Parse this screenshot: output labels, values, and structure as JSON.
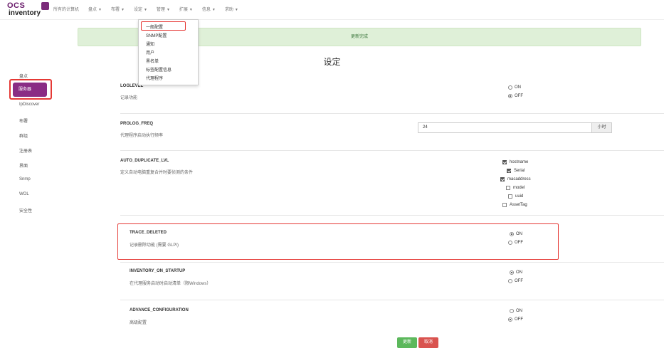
{
  "logo": {
    "line1": "OCS",
    "line2": "inventory"
  },
  "nav": [
    {
      "label": "所有的计算机",
      "caret": false
    },
    {
      "label": "盘点",
      "caret": true
    },
    {
      "label": "布署",
      "caret": true
    },
    {
      "label": "设定",
      "caret": true
    },
    {
      "label": "管理",
      "caret": true
    },
    {
      "label": "扩展",
      "caret": true
    },
    {
      "label": "信息",
      "caret": true
    },
    {
      "label": "求助",
      "caret": true
    }
  ],
  "dropdown": [
    "一般配置",
    "SNMP配置",
    "通知",
    "用户",
    "黑名单",
    "标签配置信息",
    "代理程序"
  ],
  "alert": "更新完成",
  "page_title": "设定",
  "sidebar": [
    "盘点",
    "服务器",
    "IpDiscover",
    "布署",
    "群组",
    "注册表",
    "界面",
    "Snmp",
    "WOL",
    "安全性"
  ],
  "settings": {
    "loglevel": {
      "name": "LOGLEVEL",
      "desc": "记录功能",
      "on": "ON",
      "off": "OFF",
      "selected": "OFF"
    },
    "prolog": {
      "name": "PROLOG_FREQ",
      "desc": "代理程序启动执行频率",
      "value": "24",
      "unit": "小时"
    },
    "autodup": {
      "name": "AUTO_DUPLICATE_LVL",
      "desc": "定义自动电脑重复合并时要侦测的条件",
      "options": [
        {
          "label": "hostname",
          "checked": true
        },
        {
          "label": "Serial",
          "checked": true
        },
        {
          "label": "macaddress",
          "checked": true
        },
        {
          "label": "model",
          "checked": false
        },
        {
          "label": "uuid",
          "checked": false
        },
        {
          "label": "AssetTag",
          "checked": false
        }
      ]
    },
    "trace": {
      "name": "TRACE_DELETED",
      "desc": "记录删除功能 (需要 GLPI)",
      "on": "ON",
      "off": "OFF",
      "selected": "ON"
    },
    "startup": {
      "name": "INVENTORY_ON_STARTUP",
      "desc": "在代理服务启动时启动清单（限Windows）",
      "on": "ON",
      "off": "OFF",
      "selected": "ON"
    },
    "advance": {
      "name": "ADVANCE_CONFIGURATION",
      "desc": "高级配置",
      "on": "ON",
      "off": "OFF",
      "selected": "OFF"
    }
  },
  "buttons": {
    "save": "更新",
    "cancel": "取消"
  }
}
